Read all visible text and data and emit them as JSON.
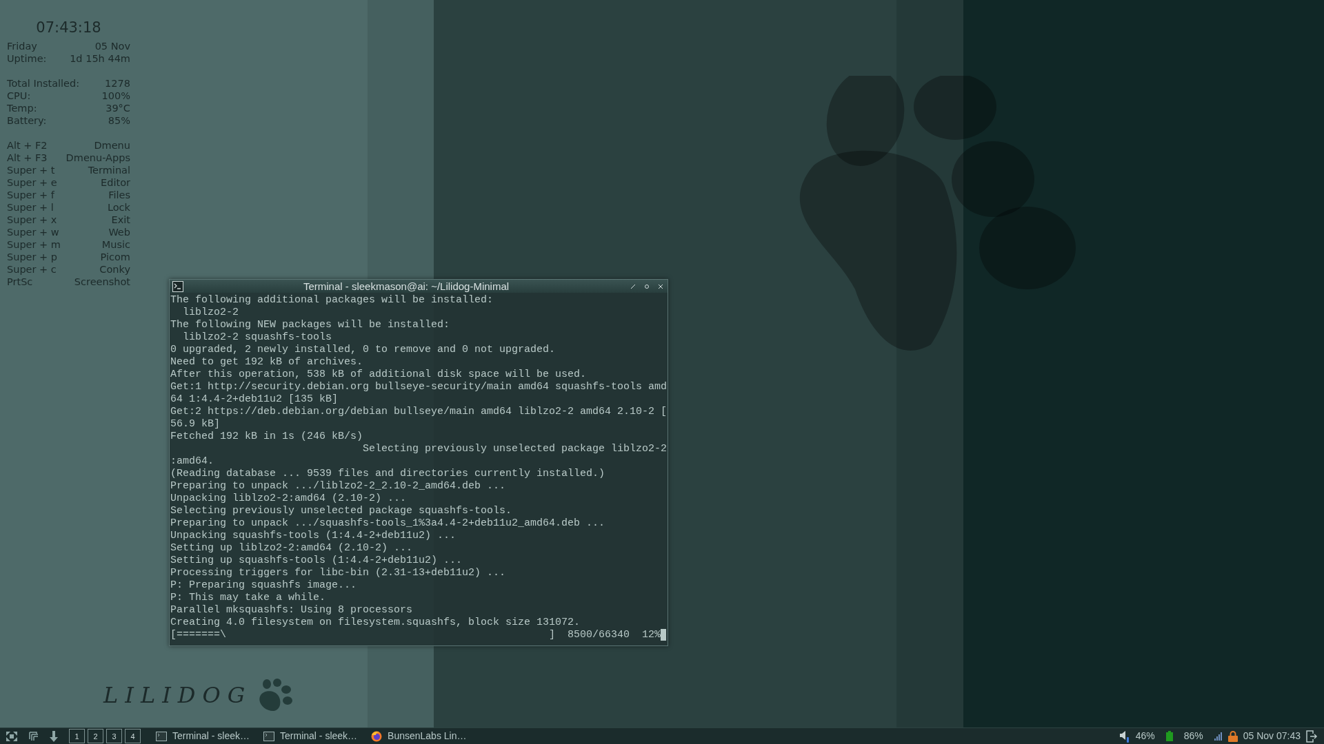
{
  "conky": {
    "clock": "07:43:18",
    "sections": [
      {
        "rows": [
          {
            "label": "Friday",
            "value": "05 Nov"
          },
          {
            "label": "Uptime:",
            "value": "1d 15h 44m"
          }
        ]
      },
      {
        "rows": [
          {
            "label": "Total Installed:",
            "value": "1278"
          },
          {
            "label": "CPU:",
            "value": "100%"
          },
          {
            "label": "Temp:",
            "value": "39°C"
          },
          {
            "label": "Battery:",
            "value": "85%"
          }
        ]
      },
      {
        "rows": [
          {
            "label": "Alt + F2",
            "value": "Dmenu"
          },
          {
            "label": "Alt + F3",
            "value": "Dmenu-Apps"
          },
          {
            "label": "Super + t",
            "value": "Terminal"
          },
          {
            "label": "Super + e",
            "value": "Editor"
          },
          {
            "label": "Super + f",
            "value": "Files"
          },
          {
            "label": "Super + l",
            "value": "Lock"
          },
          {
            "label": "Super + x",
            "value": "Exit"
          },
          {
            "label": "Super + w",
            "value": "Web"
          },
          {
            "label": "Super + m",
            "value": "Music"
          },
          {
            "label": "Super + p",
            "value": "Picom"
          },
          {
            "label": "Super + c",
            "value": "Conky"
          },
          {
            "label": "PrtSc",
            "value": "Screenshot"
          }
        ]
      }
    ]
  },
  "terminal": {
    "title": "Terminal - sleekmason@ai: ~/Lilidog-Minimal",
    "lines": [
      "The following additional packages will be installed:",
      "  liblzo2-2",
      "The following NEW packages will be installed:",
      "  liblzo2-2 squashfs-tools",
      "0 upgraded, 2 newly installed, 0 to remove and 0 not upgraded.",
      "Need to get 192 kB of archives.",
      "After this operation, 538 kB of additional disk space will be used.",
      "Get:1 http://security.debian.org bullseye-security/main amd64 squashfs-tools amd",
      "64 1:4.4-2+deb11u2 [135 kB]",
      "Get:2 https://deb.debian.org/debian bullseye/main amd64 liblzo2-2 amd64 2.10-2 [",
      "56.9 kB]",
      "Fetched 192 kB in 1s (246 kB/s)",
      "                               Selecting previously unselected package liblzo2-2",
      ":amd64.",
      "(Reading database ... 9539 files and directories currently installed.)",
      "Preparing to unpack .../liblzo2-2_2.10-2_amd64.deb ...",
      "Unpacking liblzo2-2:amd64 (2.10-2) ...",
      "Selecting previously unselected package squashfs-tools.",
      "Preparing to unpack .../squashfs-tools_1%3a4.4-2+deb11u2_amd64.deb ...",
      "Unpacking squashfs-tools (1:4.4-2+deb11u2) ...",
      "Setting up liblzo2-2:amd64 (2.10-2) ...",
      "Setting up squashfs-tools (1:4.4-2+deb11u2) ...",
      "Processing triggers for libc-bin (2.31-13+deb11u2) ...",
      "P: Preparing squashfs image...",
      "P: This may take a while.",
      "Parallel mksquashfs: Using 8 processors",
      "Creating 4.0 filesystem on filesystem.squashfs, block size 131072.",
      "[=======\\                                                    ]  8500/66340  12%"
    ]
  },
  "logo": {
    "text": "LILIDOG"
  },
  "taskbar": {
    "workspaces": [
      "1",
      "2",
      "3",
      "4"
    ],
    "tasks": [
      {
        "kind": "terminal",
        "label": "Terminal - sleek…"
      },
      {
        "kind": "terminal",
        "label": "Terminal - sleek…"
      },
      {
        "kind": "browser",
        "label": "BunsenLabs Lin…"
      }
    ],
    "tray": {
      "volume": "46%",
      "battery": "86%",
      "clock": "05 Nov 07:43"
    }
  }
}
